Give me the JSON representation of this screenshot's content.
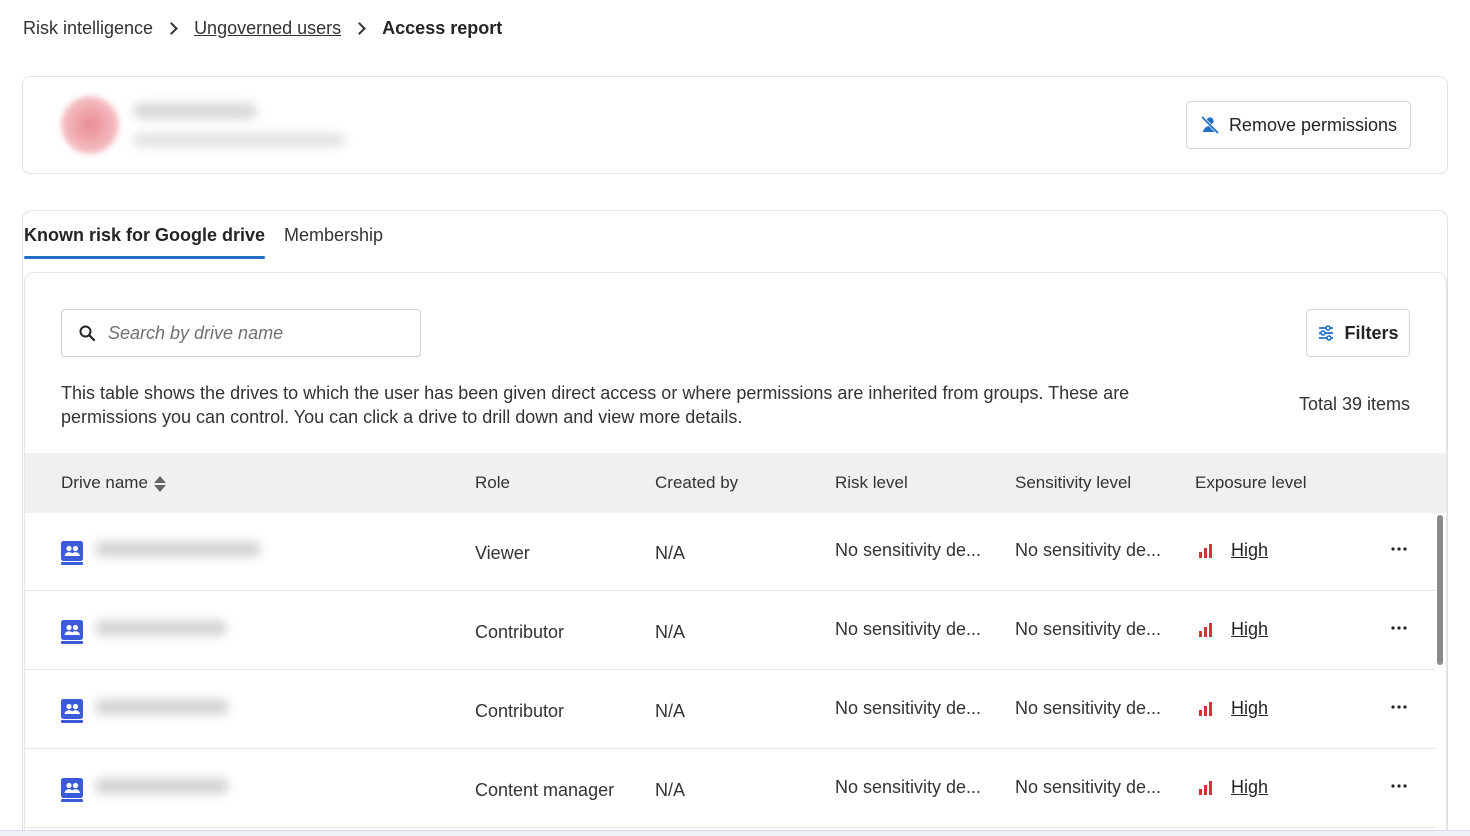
{
  "breadcrumb": {
    "items": [
      "Risk intelligence",
      "Ungoverned users",
      "Access report"
    ]
  },
  "user": {
    "remove_button_label": "Remove permissions"
  },
  "tabs": [
    "Known risk for Google drive",
    "Membership"
  ],
  "table_toolbar": {
    "search_placeholder": "Search by drive name",
    "filters_label": "Filters",
    "description": "This table shows the drives to which the user has been given direct access or where permissions are inherited from groups. These are permissions you can control. You can click a drive to drill down and view more details.",
    "total": "Total 39 items"
  },
  "columns": [
    "Drive name",
    "Role",
    "Created by",
    "Risk level",
    "Sensitivity level",
    "Exposure level"
  ],
  "rows": [
    {
      "role": "Viewer",
      "created_by": "N/A",
      "risk": "No sensitivity de...",
      "sensitivity": "No sensitivity de...",
      "exposure": "High"
    },
    {
      "role": "Contributor",
      "created_by": "N/A",
      "risk": "No sensitivity de...",
      "sensitivity": "No sensitivity de...",
      "exposure": "High"
    },
    {
      "role": "Contributor",
      "created_by": "N/A",
      "risk": "No sensitivity de...",
      "sensitivity": "No sensitivity de...",
      "exposure": "High"
    },
    {
      "role": "Content manager",
      "created_by": "N/A",
      "risk": "No sensitivity de...",
      "sensitivity": "No sensitivity de...",
      "exposure": "High"
    }
  ],
  "colors": {
    "accent": "#1f6fc5",
    "drive_icon": "#3b5bdb",
    "exposure_high": "#d13438"
  }
}
